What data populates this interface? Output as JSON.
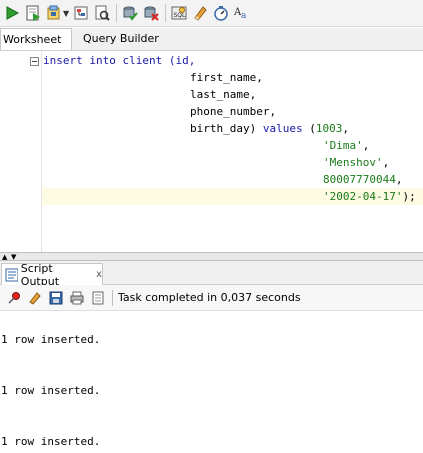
{
  "toolbar": {
    "buttons": [
      "run-statement-icon",
      "run-script-icon",
      "commit-icon",
      "rollback-icon",
      "explain-plan-icon",
      "autotrace-icon",
      "clear-icon",
      "sql-history-icon",
      "eraser-icon",
      "tuning-icon",
      "format-icon"
    ]
  },
  "tabs": {
    "worksheet": "Worksheet",
    "query_builder": "Query Builder"
  },
  "editor": {
    "lines": [
      [
        {
          "t": "insert into client (id,",
          "c": "kw"
        }
      ],
      [
        {
          "t": "first_name,",
          "c": "plain"
        }
      ],
      [
        {
          "t": "last_name,",
          "c": "plain"
        }
      ],
      [
        {
          "t": "phone_number,",
          "c": "plain"
        }
      ],
      [
        {
          "t": "birth_day) ",
          "c": "plain"
        },
        {
          "t": "values",
          "c": "kw"
        },
        {
          "t": " (",
          "c": "plain"
        },
        {
          "t": "1003",
          "c": "num"
        },
        {
          "t": ",",
          "c": "plain"
        }
      ],
      [
        {
          "t": "'Dima'",
          "c": "str"
        },
        {
          "t": ",",
          "c": "plain"
        }
      ],
      [
        {
          "t": "'Menshov'",
          "c": "str"
        },
        {
          "t": ",",
          "c": "plain"
        }
      ],
      [
        {
          "t": "80007770044",
          "c": "num"
        },
        {
          "t": ",",
          "c": "plain"
        }
      ],
      [
        {
          "t": "'2002-04-17'",
          "c": "str"
        },
        {
          "t": ");",
          "c": "plain"
        }
      ]
    ]
  },
  "output_panel": {
    "tab_label": "Script Output",
    "close": "x",
    "status": "Task completed in 0,037 seconds",
    "lines": [
      "1 row inserted.",
      "1 row inserted.",
      "1 row inserted."
    ]
  }
}
